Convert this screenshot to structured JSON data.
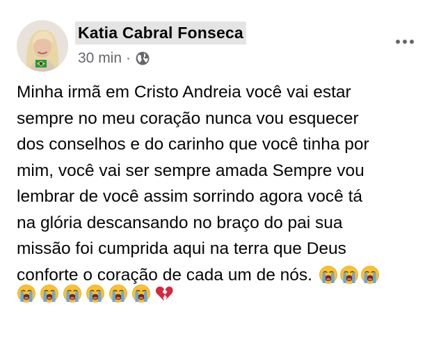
{
  "post": {
    "author_name": "Katia Cabral Fonseca",
    "time": "30 min",
    "separator": "·",
    "privacy_icon": "globe-icon",
    "more_icon": "more-options-icon",
    "lines": [
      "Minha irmã em Cristo Andreia você vai estar",
      "sempre no meu coração nunca vou esquecer",
      "dos conselhos e do carinho que você tinha por",
      "mim, você vai ser sempre amada Sempre vou",
      "lembrar de você assim sorrindo agora você tá",
      "na glória descansando no braço do pai sua",
      "missão foi cumprida aqui na terra que Deus",
      "conforte o coração de cada um de nós."
    ],
    "trailing_emojis_line1": [
      "loudly-crying-face",
      "loudly-crying-face",
      "loudly-crying-face"
    ],
    "trailing_emojis_line2": [
      "loudly-crying-face",
      "loudly-crying-face",
      "loudly-crying-face",
      "loudly-crying-face",
      "loudly-crying-face",
      "loudly-crying-face",
      "broken-heart"
    ]
  },
  "colors": {
    "name_highlight": "#e4e4e4",
    "secondary_text": "#65676b",
    "primary_text": "#050505",
    "emoji_face": "#f9c130",
    "tears": "#5ea7e8",
    "broken_heart": "#d7263d"
  }
}
